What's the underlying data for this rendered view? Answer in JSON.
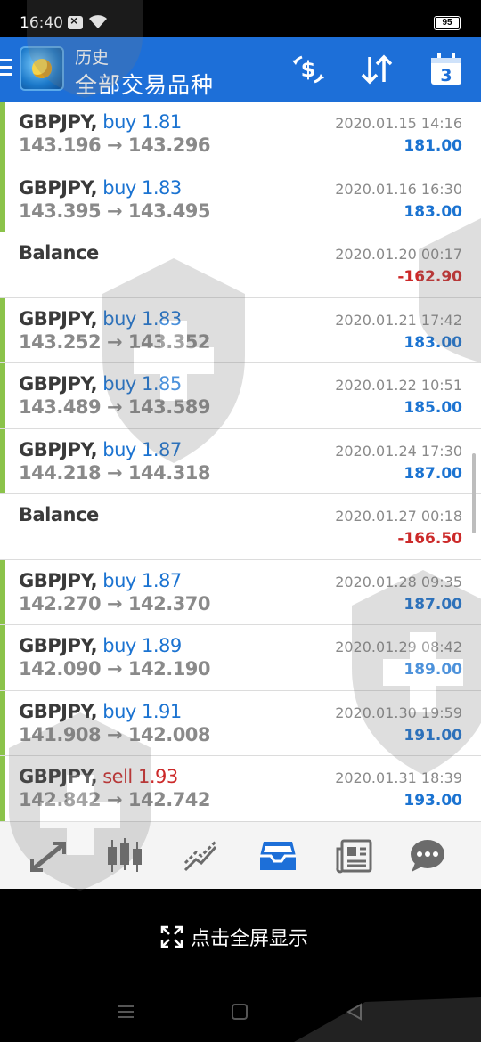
{
  "status": {
    "time": "16:40",
    "battery": "95"
  },
  "header": {
    "title": "历史",
    "subtitle": "全部交易品种"
  },
  "trades": [
    {
      "kind": "trade",
      "symbol": "GBPJPY,",
      "direction": "buy",
      "volume": "1.81",
      "open": "143.196",
      "close": "143.296",
      "date": "2020.01.15 14:16",
      "profit": "181.00"
    },
    {
      "kind": "trade",
      "symbol": "GBPJPY,",
      "direction": "buy",
      "volume": "1.83",
      "open": "143.395",
      "close": "143.495",
      "date": "2020.01.16 16:30",
      "profit": "183.00"
    },
    {
      "kind": "balance",
      "label": "Balance",
      "date": "2020.01.20 00:17",
      "profit": "-162.90"
    },
    {
      "kind": "trade",
      "symbol": "GBPJPY,",
      "direction": "buy",
      "volume": "1.83",
      "open": "143.252",
      "close": "143.352",
      "date": "2020.01.21 17:42",
      "profit": "183.00"
    },
    {
      "kind": "trade",
      "symbol": "GBPJPY,",
      "direction": "buy",
      "volume": "1.85",
      "open": "143.489",
      "close": "143.589",
      "date": "2020.01.22 10:51",
      "profit": "185.00"
    },
    {
      "kind": "trade",
      "symbol": "GBPJPY,",
      "direction": "buy",
      "volume": "1.87",
      "open": "144.218",
      "close": "144.318",
      "date": "2020.01.24 17:30",
      "profit": "187.00"
    },
    {
      "kind": "balance",
      "label": "Balance",
      "date": "2020.01.27 00:18",
      "profit": "-166.50"
    },
    {
      "kind": "trade",
      "symbol": "GBPJPY,",
      "direction": "buy",
      "volume": "1.87",
      "open": "142.270",
      "close": "142.370",
      "date": "2020.01.28 09:35",
      "profit": "187.00"
    },
    {
      "kind": "trade",
      "symbol": "GBPJPY,",
      "direction": "buy",
      "volume": "1.89",
      "open": "142.090",
      "close": "142.190",
      "date": "2020.01.29 08:42",
      "profit": "189.00"
    },
    {
      "kind": "trade",
      "symbol": "GBPJPY,",
      "direction": "buy",
      "volume": "1.91",
      "open": "141.908",
      "close": "142.008",
      "date": "2020.01.30 19:59",
      "profit": "191.00"
    },
    {
      "kind": "trade",
      "symbol": "GBPJPY,",
      "direction": "sell",
      "volume": "1.93",
      "open": "142.842",
      "close": "142.742",
      "date": "2020.01.31 18:39",
      "profit": "193.00"
    }
  ],
  "tabs": [
    {
      "icon": "quotes-icon"
    },
    {
      "icon": "chart-icon"
    },
    {
      "icon": "trade-icon"
    },
    {
      "icon": "history-icon",
      "active": true
    },
    {
      "icon": "news-icon"
    },
    {
      "icon": "chat-icon"
    }
  ],
  "fullscreen": {
    "label": "点击全屏显示"
  },
  "colors": {
    "header": "#1d6fd8",
    "buy": "#1b73d1",
    "sell": "#cc2929",
    "bar": "#8bc34a"
  }
}
